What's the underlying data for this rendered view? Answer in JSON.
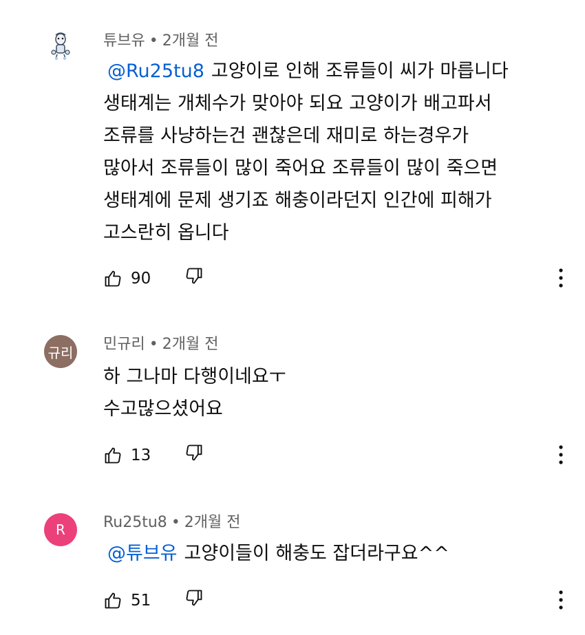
{
  "comments": [
    {
      "author": "튜브유",
      "dot": "•",
      "time": "2개월 전",
      "avatar_color": "#ffffff",
      "avatar_text": "",
      "avatar_icon": "cartoon-avatar-icon",
      "mention": "@Ru25tu8",
      "lines": [
        "고양이로 인해 조류들이 씨가 마릅니다",
        "생태계는 개체수가 맞아야 되요 고양이가 배고파서",
        "조류를 사냥하는건 괜찮은데 재미로 하는경우가",
        "많아서 조류들이 많이 죽어요 조류들이 많이 죽으면",
        "생태계에 문제 생기죠 해충이라던지 인간에 피해가",
        "고스란히 옵니다"
      ],
      "likes": "90"
    },
    {
      "author": "민규리",
      "dot": "•",
      "time": "2개월 전",
      "avatar_color": "#8d6e63",
      "avatar_text": "규리",
      "mention": "",
      "lines": [
        "하 그나마 다행이네요ㅜ",
        "수고많으셨어요"
      ],
      "likes": "13"
    },
    {
      "author": "Ru25tu8",
      "dot": "•",
      "time": "2개월 전",
      "avatar_color": "#ec407a",
      "avatar_text": "R",
      "mention": "@튜브유",
      "lines": [
        "고양이들이 해충도 잡더라구요^^"
      ],
      "likes": "51"
    }
  ],
  "icons": {
    "like": "thumbs-up-icon",
    "dislike": "thumbs-down-icon",
    "more": "more-vertical-icon"
  }
}
